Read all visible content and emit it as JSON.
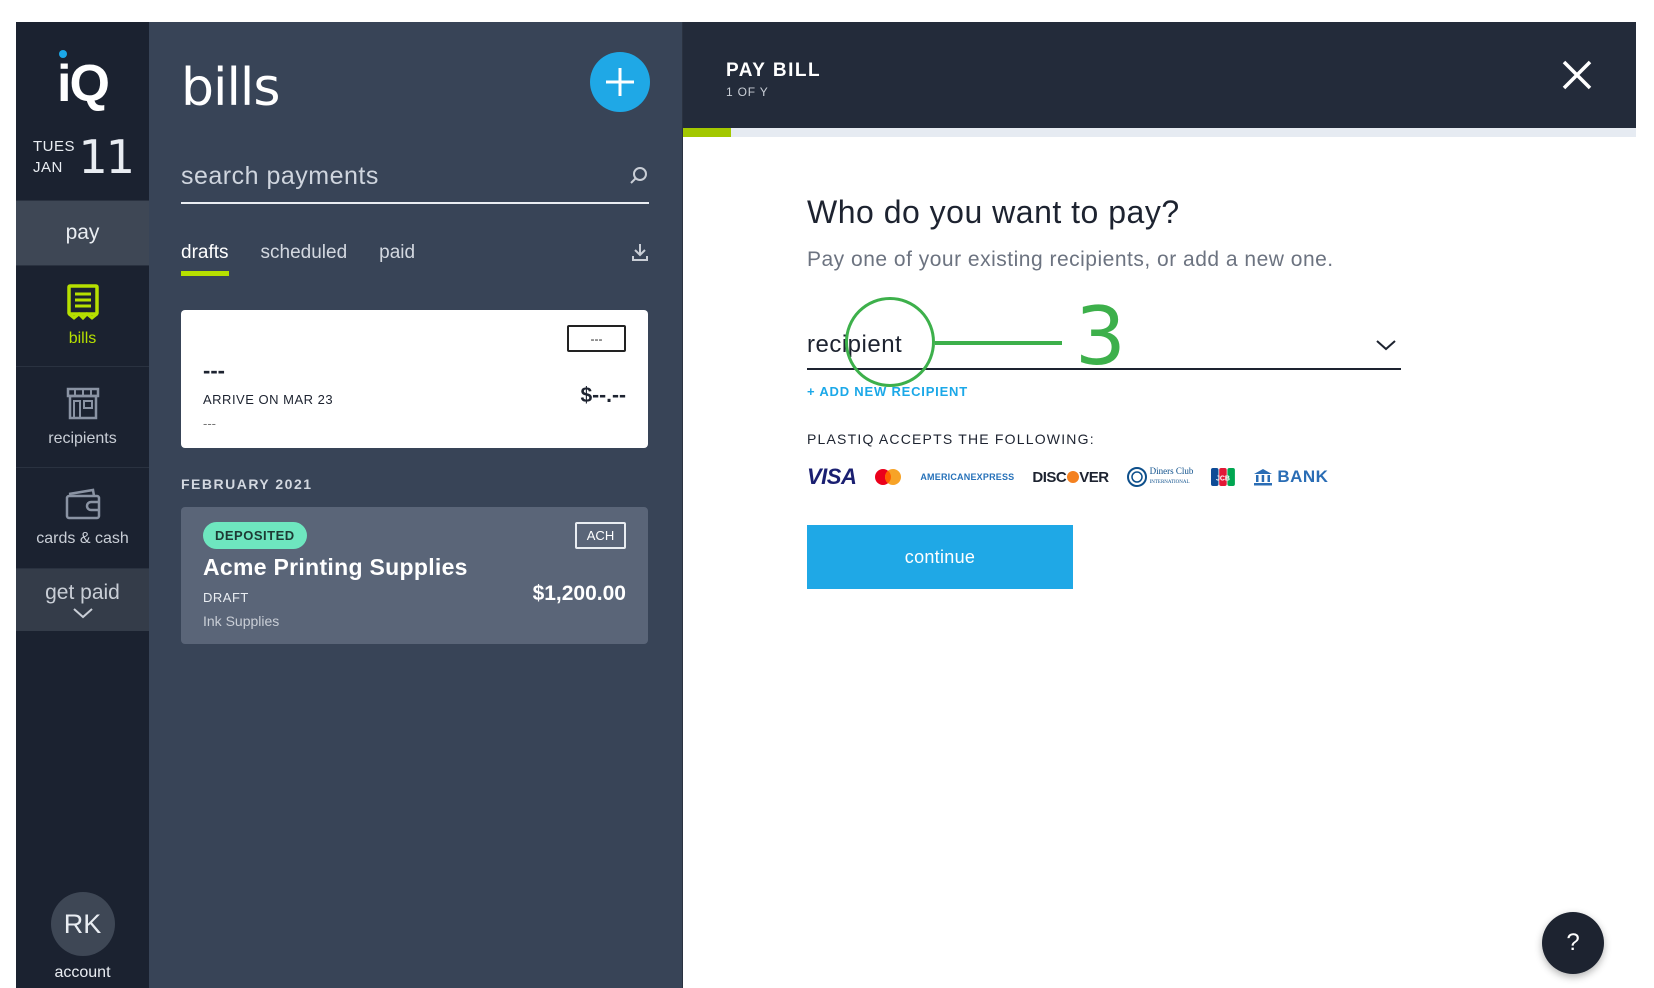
{
  "rail": {
    "logo": "iQ",
    "date": {
      "dow": "TUES",
      "month": "JAN",
      "day": "11"
    },
    "pay_label": "pay",
    "items": [
      {
        "label": "bills",
        "icon": "receipt-icon",
        "active": true
      },
      {
        "label": "recipients",
        "icon": "storefront-icon",
        "active": false
      },
      {
        "label": "cards & cash",
        "icon": "wallet-icon",
        "active": false
      }
    ],
    "get_paid_label": "get paid",
    "account": {
      "initials": "RK",
      "label": "account"
    }
  },
  "bills": {
    "title": "bills",
    "search": {
      "placeholder": "search payments",
      "value": ""
    },
    "tabs": [
      {
        "label": "drafts",
        "active": true
      },
      {
        "label": "scheduled",
        "active": false
      },
      {
        "label": "paid",
        "active": false
      }
    ],
    "draft_card": {
      "badge": "---",
      "name": "---",
      "arrive": "ARRIVE ON MAR 23",
      "memo": "---",
      "amount": "$--.--"
    },
    "section_label": "FEBRUARY 2021",
    "bill_card": {
      "status": "DEPOSITED",
      "method": "ACH",
      "name": "Acme Printing Supplies",
      "state": "DRAFT",
      "memo": "Ink Supplies",
      "amount": "$1,200.00"
    }
  },
  "panel": {
    "title": "PAY BILL",
    "step": "1 OF Y",
    "progress": 0.05,
    "question": "Who do you want to pay?",
    "subtitle": "Pay one of your existing recipients, or add a new one.",
    "select": {
      "value": "recipient"
    },
    "add_recipient": "+ ADD NEW RECIPIENT",
    "accepts_label": "PLASTIQ ACCEPTS THE FOLLOWING:",
    "payment_methods": {
      "visa": "VISA",
      "amex_line1": "AMERICAN",
      "amex_line2": "EXPRESS",
      "discover_a": "DISC",
      "discover_b": "VER",
      "diners_line1": "Diners Club",
      "diners_line2": "INTERNATIONAL",
      "jcb": "JCB",
      "bank": "BANK"
    },
    "continue_label": "continue",
    "annotation_number": "3",
    "help_label": "?"
  },
  "colors": {
    "accent_green": "#b6e000",
    "primary_blue": "#1fa8e6",
    "annotation_green": "#3db04b",
    "deposited_badge": "#6ee6bf"
  }
}
